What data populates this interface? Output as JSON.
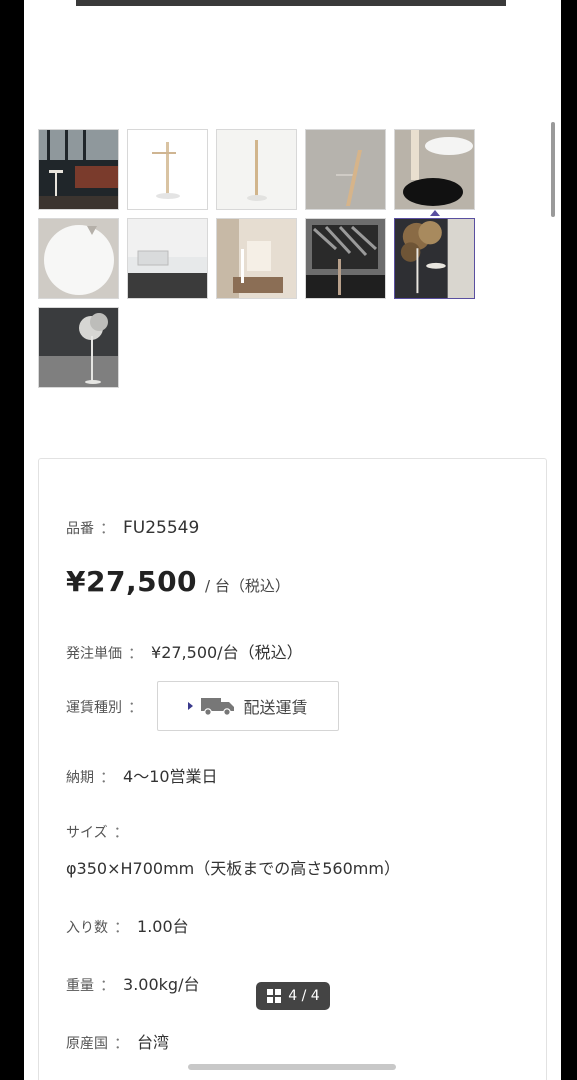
{
  "gallery": {
    "thumbnails": [
      {
        "name": "thumb-living-room",
        "colors": [
          "#1d2226",
          "#7a3b2c",
          "#9ba3a8"
        ]
      },
      {
        "name": "thumb-lamp-front",
        "colors": [
          "#ffffff",
          "#d9c3a2",
          "#e8e8e8"
        ]
      },
      {
        "name": "thumb-lamp-angle",
        "colors": [
          "#f4f4f2",
          "#d1b58c",
          "#eaeaea"
        ]
      },
      {
        "name": "thumb-lamp-detail",
        "colors": [
          "#b6b3ad",
          "#d6b48a",
          "#a9a6a0"
        ]
      },
      {
        "name": "thumb-base-closeup",
        "colors": [
          "#b9b3a9",
          "#111111",
          "#e9dfcf"
        ]
      },
      {
        "name": "thumb-top-view",
        "colors": [
          "#cfcbc5",
          "#f7f7f6",
          "#b5b0a9"
        ]
      },
      {
        "name": "thumb-table-detail",
        "colors": [
          "#d9dbdc",
          "#3b3b3b",
          "#f1f1f1"
        ]
      },
      {
        "name": "thumb-bedroom",
        "colors": [
          "#e6ddd1",
          "#8b6e55",
          "#c7b9a6"
        ]
      },
      {
        "name": "thumb-bookshelf",
        "colors": [
          "#6d6d6d",
          "#2a2a2a",
          "#b8a08b"
        ]
      },
      {
        "name": "thumb-plant-scene",
        "colors": [
          "#2e2f33",
          "#d9d6cf",
          "#8a6b45"
        ]
      },
      {
        "name": "thumb-plant-dark",
        "colors": [
          "#3a3c3e",
          "#d6d6d3",
          "#7f7f7f"
        ]
      }
    ],
    "selected_index": 9
  },
  "product": {
    "code_label": "品番",
    "code_value": "FU25549",
    "price_main": "¥27,500",
    "price_unit": "/ 台（税込）",
    "order_price_label": "発注単価",
    "order_price_value": "¥27,500/台（税込）",
    "shipping_label": "運賃種別",
    "shipping_button": "配送運賃",
    "delivery_label": "納期",
    "delivery_value": "4〜10営業日",
    "size_label": "サイズ",
    "size_value": "φ350×H700mm（天板までの高さ560mm）",
    "quantity_label": "入り数",
    "quantity_value": "1.00台",
    "weight_label": "重量",
    "weight_value": "3.00kg/台",
    "origin_label": "原産国",
    "origin_value": "台湾",
    "separator": "："
  },
  "overlay": {
    "counter_text": "4 / 4"
  }
}
